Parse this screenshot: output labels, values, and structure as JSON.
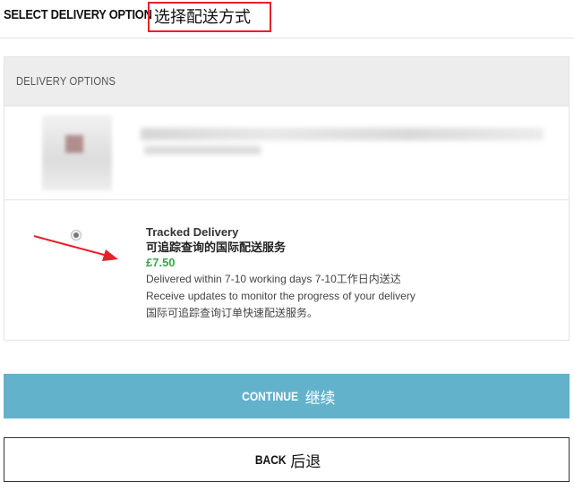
{
  "header": {
    "title": "SELECT DELIVERY OPTION",
    "title_cn": "选择配送方式"
  },
  "panel": {
    "heading": "DELIVERY OPTIONS"
  },
  "option": {
    "name": "Tracked Delivery",
    "name_cn": "可追踪查询的国际配送服务",
    "price": "£7.50",
    "delivery_time": "Delivered within 7-10 working days 7-10工作日内送达",
    "description": "Receive updates to monitor the progress of your delivery",
    "description_cn": "国际可追踪查询订单快速配送服务。",
    "selected": true
  },
  "buttons": {
    "continue_label": "CONTINUE",
    "continue_cn": "继续",
    "back_label": "BACK",
    "back_cn": "后退"
  },
  "colors": {
    "continue_bg": "#62b2cb",
    "price": "#3aa64a",
    "highlight_box": "#e8202a",
    "arrow": "#e8202a"
  }
}
